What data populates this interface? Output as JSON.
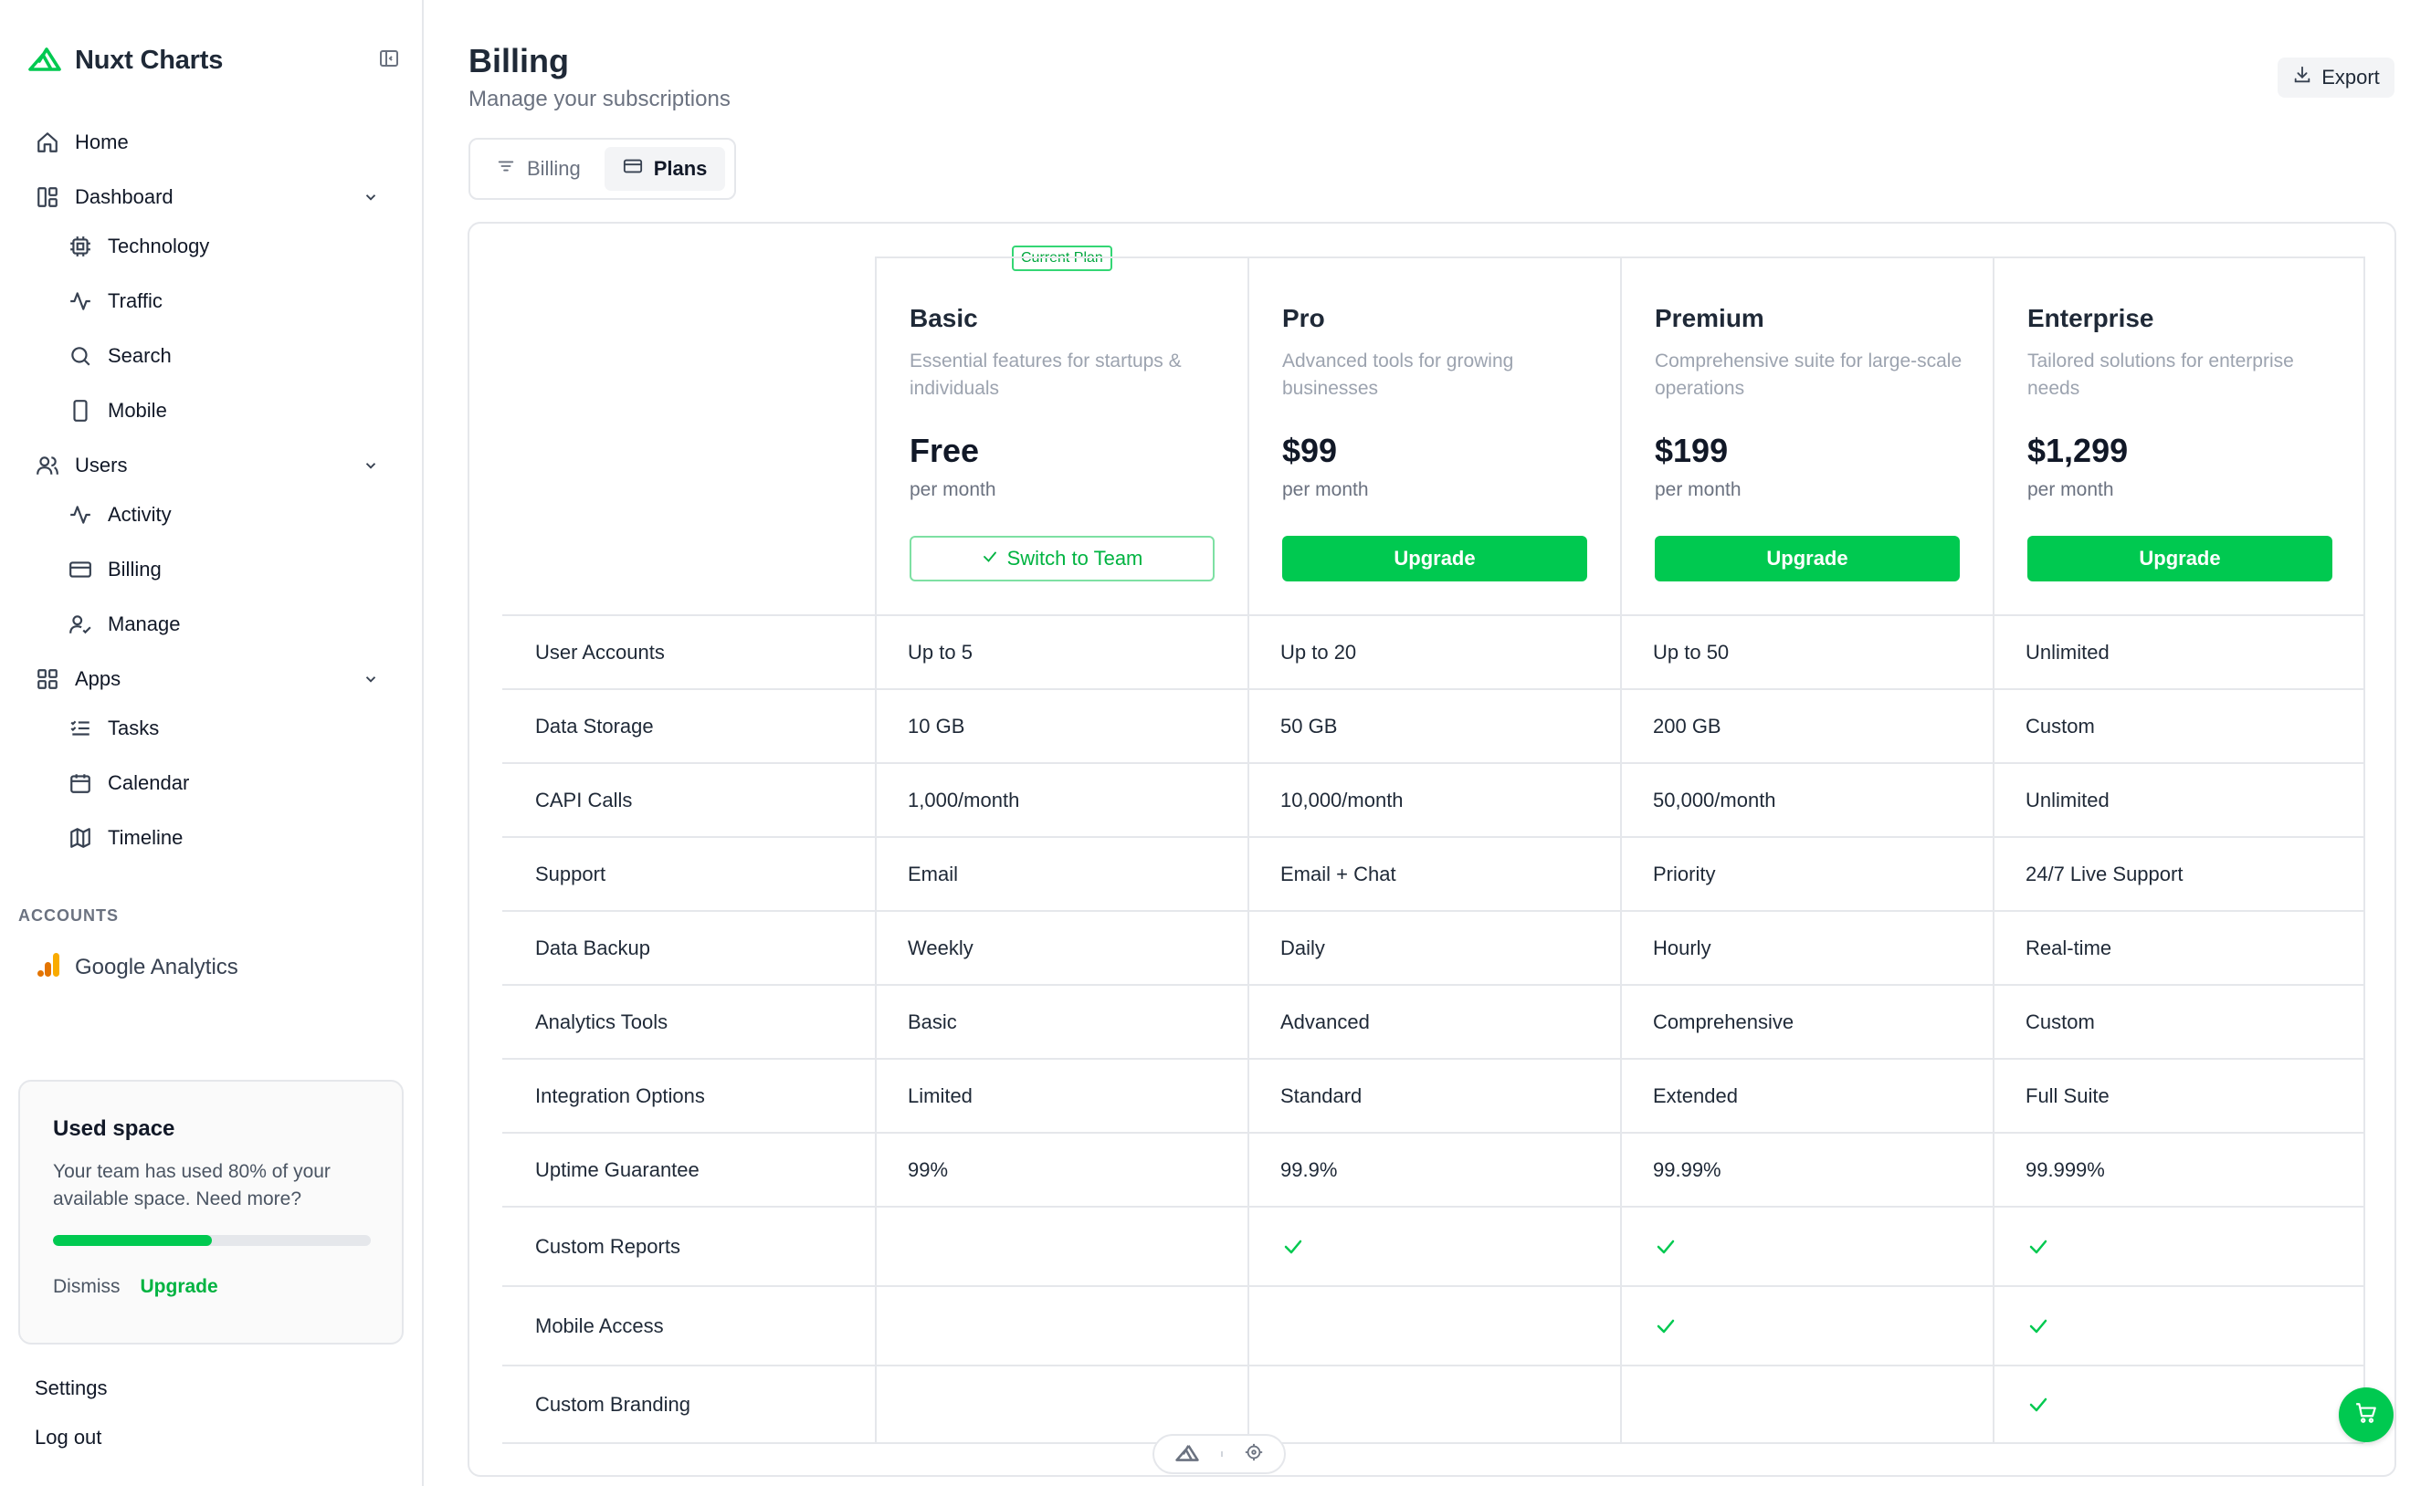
{
  "sidebar": {
    "brand": "Nuxt Charts",
    "nav": [
      {
        "label": "Home",
        "icon": "home-icon"
      },
      {
        "label": "Dashboard",
        "icon": "dashboard-icon",
        "children": [
          {
            "label": "Technology",
            "icon": "cpu-icon"
          },
          {
            "label": "Traffic",
            "icon": "activity-icon"
          },
          {
            "label": "Search",
            "icon": "search-icon"
          },
          {
            "label": "Mobile",
            "icon": "mobile-icon"
          }
        ]
      },
      {
        "label": "Users",
        "icon": "users-icon",
        "children": [
          {
            "label": "Activity",
            "icon": "activity-icon"
          },
          {
            "label": "Billing",
            "icon": "credit-card-icon"
          },
          {
            "label": "Manage",
            "icon": "user-check-icon"
          }
        ]
      },
      {
        "label": "Apps",
        "icon": "grid-icon",
        "children": [
          {
            "label": "Tasks",
            "icon": "list-check-icon"
          },
          {
            "label": "Calendar",
            "icon": "calendar-icon"
          },
          {
            "label": "Timeline",
            "icon": "map-icon"
          }
        ]
      }
    ],
    "accounts_label": "ACCOUNTS",
    "accounts": [
      {
        "label": "Google Analytics",
        "icon": "google-analytics-icon"
      }
    ],
    "space_card": {
      "title": "Used space",
      "description": "Your team has used 80% of your available space. Need more?",
      "progress": 0.5,
      "dismiss": "Dismiss",
      "upgrade": "Upgrade"
    },
    "footer": {
      "settings": "Settings",
      "logout": "Log out"
    }
  },
  "header": {
    "title": "Billing",
    "subtitle": "Manage your subscriptions",
    "export_label": "Export"
  },
  "tabs": [
    {
      "label": "Billing",
      "icon": "filter-icon",
      "active": false
    },
    {
      "label": "Plans",
      "icon": "credit-card-icon",
      "active": true
    }
  ],
  "plans": [
    {
      "name": "Basic",
      "description": "Essential features for startups & individuals",
      "price": "Free",
      "period": "per month",
      "button": "Switch to Team",
      "current": true,
      "badge": "Current Plan"
    },
    {
      "name": "Pro",
      "description": "Advanced tools for growing businesses",
      "price": "$99",
      "period": "per month",
      "button": "Upgrade",
      "current": false
    },
    {
      "name": "Premium",
      "description": "Comprehensive suite for large-scale operations",
      "price": "$199",
      "period": "per month",
      "button": "Upgrade",
      "current": false
    },
    {
      "name": "Enterprise",
      "description": "Tailored solutions for enterprise needs",
      "price": "$1,299",
      "period": "per month",
      "button": "Upgrade",
      "current": false
    }
  ],
  "features": [
    {
      "name": "User Accounts",
      "values": [
        "Up to 5",
        "Up to 20",
        "Up to 50",
        "Unlimited"
      ]
    },
    {
      "name": "Data Storage",
      "values": [
        "10 GB",
        "50 GB",
        "200 GB",
        "Custom"
      ]
    },
    {
      "name": "CAPI Calls",
      "values": [
        "1,000/month",
        "10,000/month",
        "50,000/month",
        "Unlimited"
      ]
    },
    {
      "name": "Support",
      "values": [
        "Email",
        "Email + Chat",
        "Priority",
        "24/7 Live Support"
      ]
    },
    {
      "name": "Data Backup",
      "values": [
        "Weekly",
        "Daily",
        "Hourly",
        "Real-time"
      ]
    },
    {
      "name": "Analytics Tools",
      "values": [
        "Basic",
        "Advanced",
        "Comprehensive",
        "Custom"
      ]
    },
    {
      "name": "Integration Options",
      "values": [
        "Limited",
        "Standard",
        "Extended",
        "Full Suite"
      ]
    },
    {
      "name": "Uptime Guarantee",
      "values": [
        "99%",
        "99.9%",
        "99.99%",
        "99.999%"
      ]
    },
    {
      "name": "Custom Reports",
      "values": [
        false,
        true,
        true,
        true
      ]
    },
    {
      "name": "Mobile Access",
      "values": [
        false,
        false,
        true,
        true
      ]
    },
    {
      "name": "Custom Branding",
      "values": [
        false,
        false,
        false,
        true
      ]
    }
  ],
  "colors": {
    "accent": "#00c950",
    "border": "#e5e7eb",
    "muted": "#6b7280"
  }
}
